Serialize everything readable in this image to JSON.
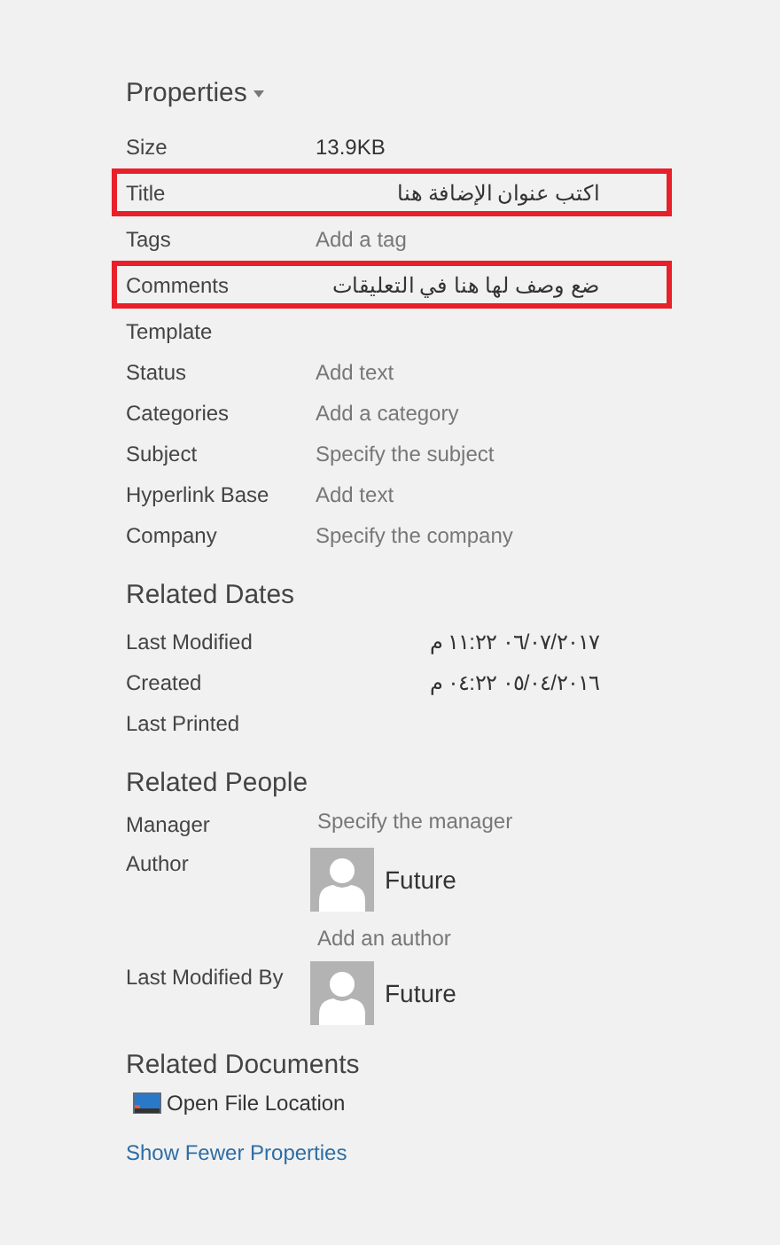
{
  "header": {
    "title": "Properties"
  },
  "properties": [
    {
      "label": "Size",
      "value": "13.9KB",
      "kind": "value",
      "highlighted": false
    },
    {
      "label": "Title",
      "value": "اكتب عنوان الإضافة هنا",
      "kind": "value",
      "highlighted": true
    },
    {
      "label": "Tags",
      "value": "Add a tag",
      "kind": "placeholder",
      "highlighted": false
    },
    {
      "label": "Comments",
      "value": "ضع وصف لها هنا في التعليقات",
      "kind": "value",
      "highlighted": true
    },
    {
      "label": "Template",
      "highlighted": false
    },
    {
      "label": "Status",
      "value": "Add text",
      "kind": "placeholder",
      "highlighted": false
    },
    {
      "label": "Categories",
      "value": "Add a category",
      "kind": "placeholder",
      "highlighted": false
    },
    {
      "label": "Subject",
      "value": "Specify the subject",
      "kind": "placeholder",
      "highlighted": false
    },
    {
      "label": "Hyperlink Base",
      "value": "Add text",
      "kind": "placeholder",
      "highlighted": false
    },
    {
      "label": "Company",
      "value": "Specify the company",
      "kind": "placeholder",
      "highlighted": false
    }
  ],
  "related_dates": {
    "title": "Related Dates",
    "rows": [
      {
        "label": "Last Modified",
        "value": "٠٦/٠٧/٢٠١٧ ١١:٢٢ م"
      },
      {
        "label": "Created",
        "value": "٠٥/٠٤/٢٠١٦ ٠٤:٢٢ م"
      },
      {
        "label": "Last Printed"
      }
    ]
  },
  "related_people": {
    "title": "Related People",
    "rows": [
      {
        "label": "Manager",
        "kind": "placeholder",
        "value": "Specify the manager"
      },
      {
        "label": "Author",
        "kind": "person",
        "name": "Future",
        "add": "Add an author"
      },
      {
        "label": "Last Modified By",
        "kind": "person",
        "name": "Future"
      }
    ]
  },
  "related_documents": {
    "title": "Related Documents",
    "items": [
      {
        "label": "Open File Location"
      }
    ]
  },
  "show_link": "Show Fewer Properties"
}
